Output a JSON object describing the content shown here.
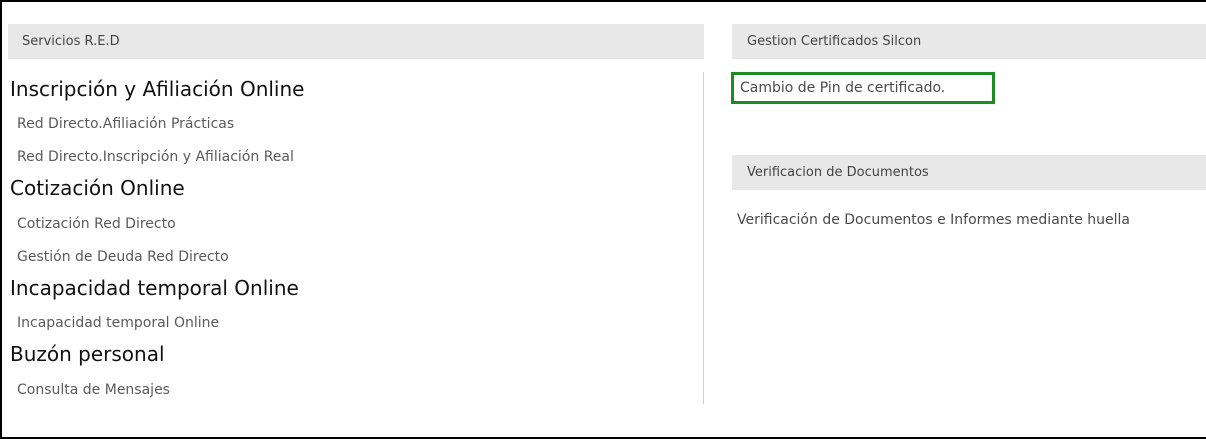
{
  "left": {
    "header": "Servicios R.E.D",
    "sections": [
      {
        "title": "Inscripción y Afiliación Online",
        "links": [
          "Red Directo.Afiliación Prácticas",
          "Red Directo.Inscripción y Afiliación Real"
        ]
      },
      {
        "title": "Cotización Online",
        "links": [
          "Cotización Red Directo",
          "Gestión de Deuda Red Directo"
        ]
      },
      {
        "title": "Incapacidad temporal Online",
        "links": [
          "Incapacidad temporal Online"
        ]
      },
      {
        "title": "Buzón personal",
        "links": [
          "Consulta de Mensajes"
        ]
      }
    ]
  },
  "right": {
    "certificados": {
      "header": "Gestion Certificados Silcon",
      "link": "Cambio de Pin de certificado."
    },
    "verificacion": {
      "header": "Verificacion de Documentos",
      "link": "Verificación de Documentos e Informes mediante huella"
    }
  },
  "colors": {
    "header_bg": "#e8e8e8",
    "highlight_border": "#1f8b24",
    "link_text": "#5a5a5a"
  }
}
